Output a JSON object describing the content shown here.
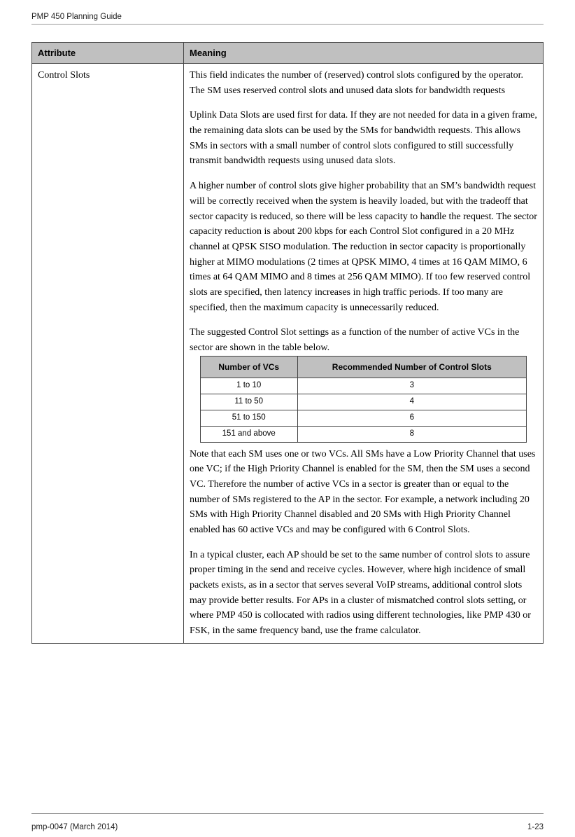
{
  "header": "PMP 450 Planning Guide",
  "footer": {
    "left": "pmp-0047 (March 2014)",
    "right": "1-23"
  },
  "mainTable": {
    "headers": {
      "attribute": "Attribute",
      "meaning": "Meaning"
    },
    "row": {
      "attribute": "Control Slots",
      "p1": "This field indicates the number of (reserved) control slots configured by the operator. The SM uses reserved control slots and unused data slots for bandwidth requests",
      "p2": "Uplink Data Slots are used first for data. If they are not needed for data in a given frame, the remaining data slots can be used by the SMs for bandwidth requests. This allows SMs in sectors with a small number of control slots configured to still successfully transmit bandwidth requests using unused data slots.",
      "p3": "A higher number of control slots give higher probability that an SM’s bandwidth request will be correctly received when the system is heavily loaded, but with the tradeoff that sector capacity is reduced, so there will be less capacity to handle the request. The sector capacity reduction is about 200 kbps for each Control Slot configured in a 20 MHz channel at QPSK SISO modulation. The reduction in sector capacity is proportionally higher at MIMO modulations (2 times at QPSK MIMO, 4 times at 16 QAM MIMO, 6 times at 64 QAM MIMO and 8 times at 256 QAM MIMO).  If too few reserved control slots are specified, then latency increases in high traffic periods. If too many are specified, then the maximum capacity is unnecessarily reduced.",
      "p4": "The suggested Control Slot settings as a function of the number of active VCs in the sector are shown in the table below.",
      "p5": "Note that each SM uses one or two VCs. All SMs have a Low Priority Channel that uses one VC; if the High Priority Channel is enabled for the SM, then the SM uses a second VC. Therefore the number of active VCs in a sector is greater than or equal to the number of SMs registered to the AP in the sector. For example, a network including 20 SMs with High Priority Channel disabled and 20 SMs with High Priority Channel enabled has 60 active VCs and may be configured with 6 Control Slots.",
      "p6": "In a typical cluster, each AP should be set to the same number of control slots to assure proper timing in the send and receive cycles. However, where high incidence of small packets exists, as in a sector that serves several VoIP streams, additional control slots may provide better results. For APs in a cluster of mismatched control slots setting, or where PMP 450 is collocated with radios using different technologies, like PMP 430 or FSK, in the same frequency band, use the frame calculator."
    }
  },
  "innerTable": {
    "headers": {
      "vcs": "Number of VCs",
      "slots": "Recommended Number of Control Slots"
    },
    "rows": [
      {
        "vcs": "1 to 10",
        "slots": "3"
      },
      {
        "vcs": "11 to 50",
        "slots": "4"
      },
      {
        "vcs": "51 to 150",
        "slots": "6"
      },
      {
        "vcs": "151 and above",
        "slots": "8"
      }
    ]
  }
}
